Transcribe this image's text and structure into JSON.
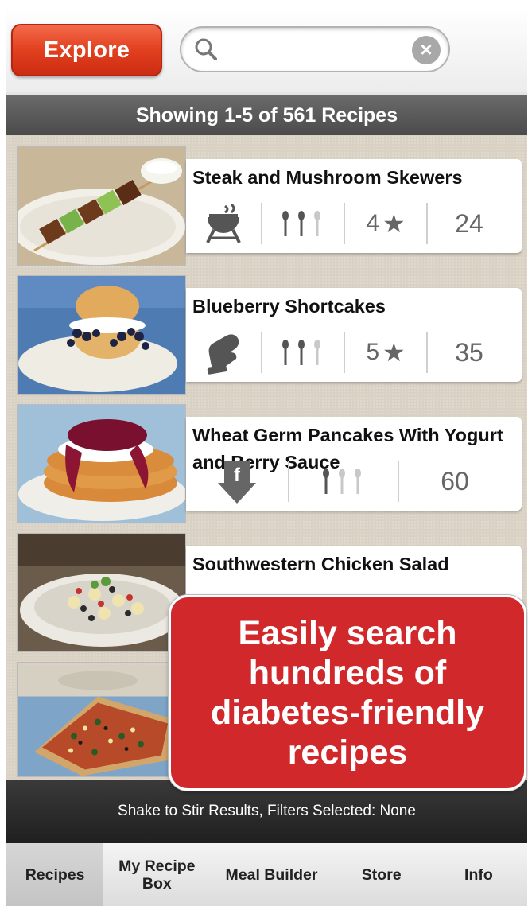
{
  "header": {
    "explore_label": "Explore",
    "search": {
      "placeholder": "",
      "value": ""
    }
  },
  "results": {
    "summary": "Showing 1-5 of 561 Recipes"
  },
  "recipes": [
    {
      "title": "Steak and Mushroom Skewers",
      "icon": "grill-icon",
      "meals": 2,
      "rating": "4",
      "count": "24"
    },
    {
      "title": "Blueberry Shortcakes",
      "icon": "oven-mitt-icon",
      "meals": 2,
      "rating": "5",
      "count": "35"
    },
    {
      "title": "Wheat Germ Pancakes With Yogurt and Berry Sauce",
      "icon": "facebook-download-icon",
      "meals": 1,
      "count": "60"
    },
    {
      "title": "Southwestern Chicken Salad"
    },
    {
      "title": ""
    }
  ],
  "promo": {
    "lines": [
      "Easily search",
      "hundreds of",
      "diabetes-friendly",
      "recipes"
    ]
  },
  "status": "Shake to Stir Results, Filters Selected: None",
  "tabs": [
    {
      "label": "Recipes",
      "active": true
    },
    {
      "label": "My Recipe Box"
    },
    {
      "label": "Meal Builder"
    },
    {
      "label": "Store"
    },
    {
      "label": "Info"
    }
  ],
  "colors": {
    "accent": "#e2401f",
    "promo": "#d0282b",
    "header_bar": "#555555"
  }
}
